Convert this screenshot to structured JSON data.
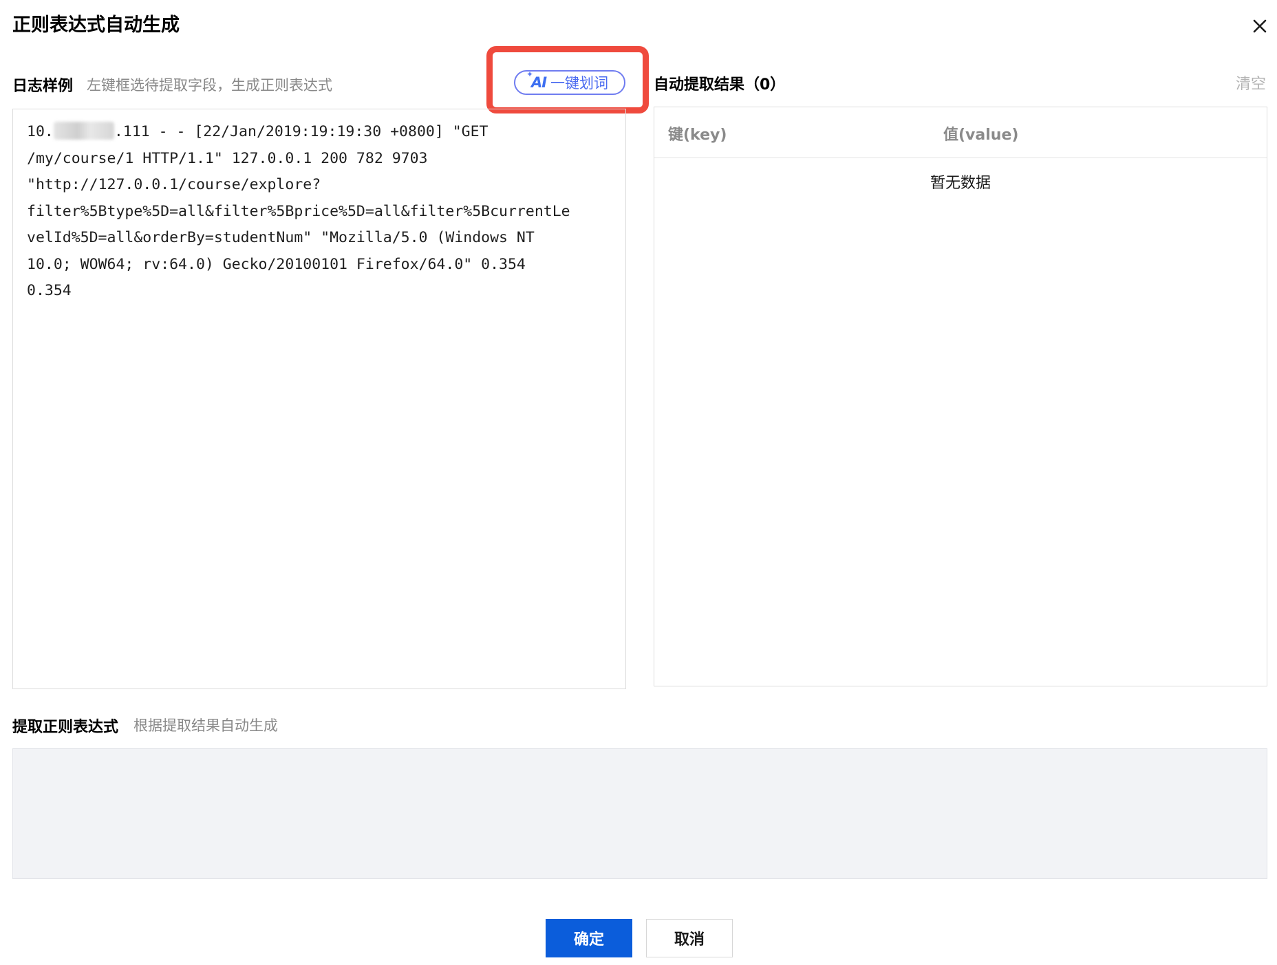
{
  "dialog": {
    "title": "正则表达式自动生成",
    "close_icon": "close-icon"
  },
  "log_sample": {
    "label": "日志样例",
    "hint": "左键框选待提取字段，生成正则表达式",
    "lines": [
      {
        "prefix": "10.",
        "suffix": ".111 - - [22/Jan/2019:19:19:30 +0800] \"GET"
      },
      "/my/course/1 HTTP/1.1\" 127.0.0.1 200 782 9703",
      "\"http://127.0.0.1/course/explore?",
      "filter%5Btype%5D=all&filter%5Bprice%5D=all&filter%5BcurrentLe",
      "velId%5D=all&orderBy=studentNum\" \"Mozilla/5.0 (Windows NT",
      "10.0; WOW64; rv:64.0) Gecko/20100101 Firefox/64.0\" 0.354",
      "0.354"
    ]
  },
  "ai_button": {
    "badge": "AI",
    "label": "一键划词",
    "icon": "ai-sparkle-icon",
    "highlight_color": "#ef4a3d"
  },
  "results": {
    "label": "自动提取结果（0）",
    "clear": "清空",
    "columns": {
      "key": "键(key)",
      "value": "值(value)"
    },
    "empty_text": "暂无数据"
  },
  "regex": {
    "label": "提取正则表达式",
    "hint": "根据提取结果自动生成",
    "value": ""
  },
  "footer": {
    "confirm": "确定",
    "cancel": "取消"
  },
  "colors": {
    "primary": "#0b5ddb",
    "ai_blue": "#4b6bf0",
    "hint_gray": "#888888",
    "regex_bg": "#f2f3f6"
  }
}
